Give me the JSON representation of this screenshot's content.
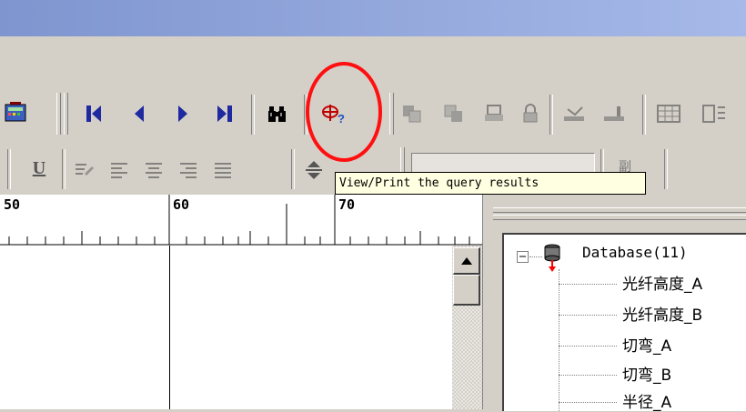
{
  "tooltip": {
    "text": "View/Print the query results"
  },
  "ruler": {
    "labels": [
      "50",
      "60",
      "70"
    ]
  },
  "tree": {
    "root_label": "Database(11)",
    "root_expander": "⊟",
    "items": [
      "光纤高度_A",
      "光纤高度_B",
      "切弯_A",
      "切弯_B",
      "半径_A"
    ]
  },
  "toolbar2": {
    "underline_label": "U",
    "field_label": "副"
  },
  "colors": {
    "highlight": "#ff1010",
    "nav_blue": "#1f2aa0",
    "tooltip_bg": "#ffffe1"
  },
  "icons": {
    "toolbar1": [
      "calculator-icon",
      "first-record-icon",
      "previous-record-icon",
      "next-record-icon",
      "last-record-icon",
      "find-binoculars-icon",
      "query-results-icon",
      "copy-icon",
      "paste-icon",
      "print-icon",
      "lock-icon",
      "import-icon",
      "export-icon",
      "grid-icon"
    ],
    "toolbar2": [
      "underline-icon",
      "format-painter-icon",
      "align-left-icon",
      "align-center-icon",
      "align-right-icon",
      "justify-icon",
      "line-spacing-icon"
    ],
    "tree": [
      "database-icon"
    ]
  }
}
